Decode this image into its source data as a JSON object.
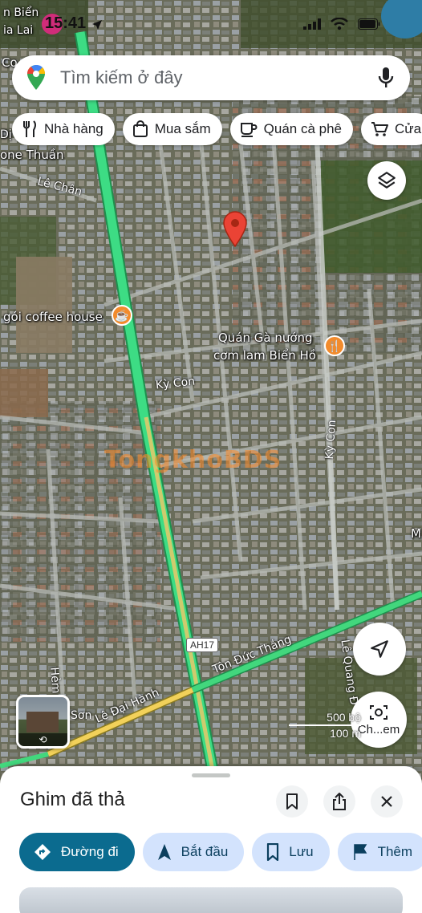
{
  "status_bar": {
    "time": "15:41"
  },
  "search": {
    "placeholder": "Tìm kiếm ở đây"
  },
  "chips": [
    {
      "label": "Nhà hàng",
      "icon": "fork-knife-icon"
    },
    {
      "label": "Mua sắm",
      "icon": "shopping-bag-icon"
    },
    {
      "label": "Quán cà phê",
      "icon": "coffee-cup-icon"
    },
    {
      "label": "Cửa",
      "icon": "shopping-cart-icon"
    }
  ],
  "map": {
    "labels": {
      "ben": "n Biển",
      "gia_lai": "ia Lai",
      "co": "Co",
      "di": "Dị",
      "thuan": "one Thuần",
      "le_chan": "Lê Chân",
      "coffee": "gói coffee house",
      "quan_ga_1": "Quán Gà nướng",
      "quan_ga_2": "cơm lam Biển Hồ",
      "ky_con_1": "Kỳ Con",
      "ky_con_2": "Kỳ Con",
      "m": "M",
      "ton_duc_thang": "Tôn Đức Thắng",
      "le_quang": "Lê Quang Đ",
      "le_dai_hanh": "Lê Đại Hành",
      "hem": "Hẻm",
      "son": "Sơn",
      "ah17": "AH17"
    },
    "watermark": "TongkhoBDS",
    "scale": {
      "imperial": "500 bộ",
      "metric": "100 m"
    },
    "screenshot_button": "Ch...em"
  },
  "sheet": {
    "title": "Ghim đã thả",
    "actions": [
      {
        "label": "Đường đi",
        "icon": "directions-icon"
      },
      {
        "label": "Bắt đầu",
        "icon": "navigation-arrow-icon"
      },
      {
        "label": "Lưu",
        "icon": "bookmark-icon"
      },
      {
        "label": "Thêm",
        "icon": "flag-icon"
      }
    ]
  },
  "colors": {
    "highway": "#3ddc84",
    "primary_action": "#0b6b8f",
    "secondary_action": "#d3e3fd",
    "pin": "#ea4335",
    "poi": "#f28b2c"
  }
}
